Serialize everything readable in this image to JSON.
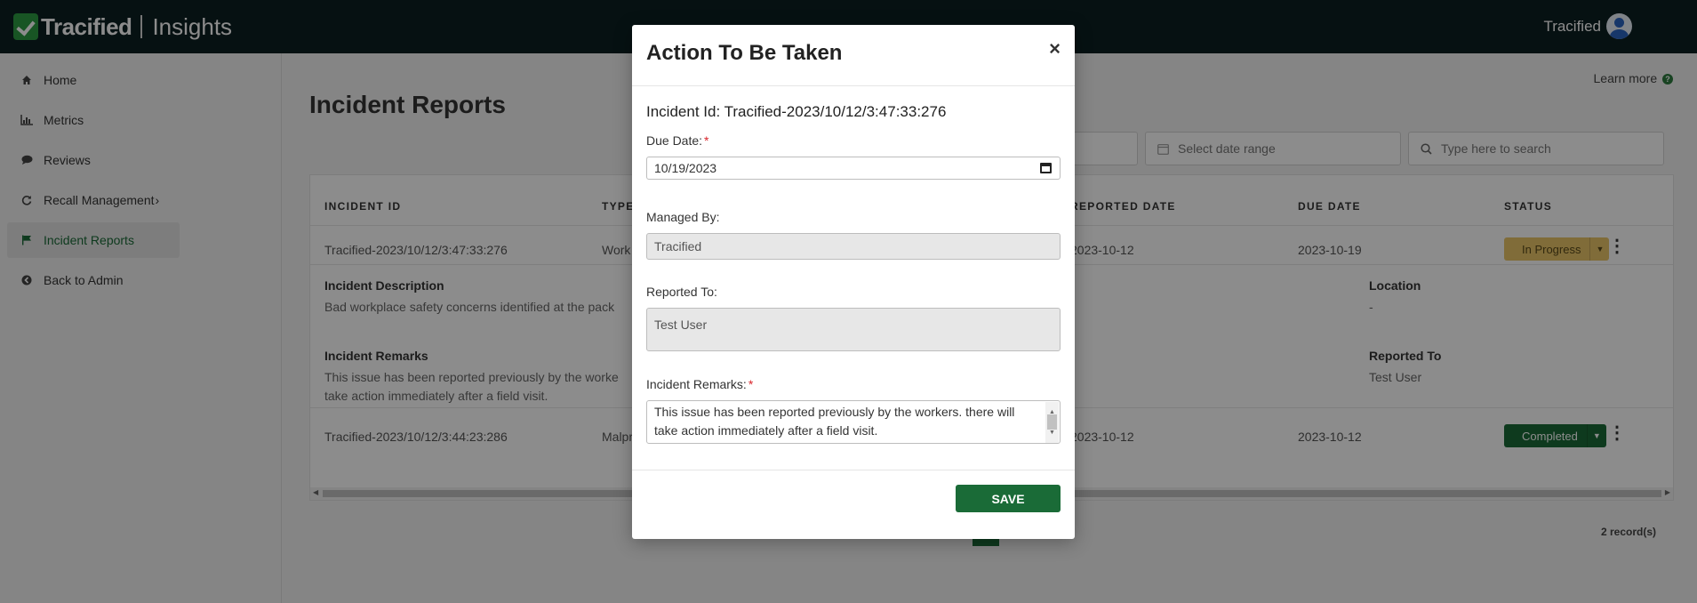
{
  "app": {
    "brand": "Tracified",
    "product": "Insights",
    "user_name": "Tracified"
  },
  "sidebar": {
    "items": [
      {
        "label": "Home",
        "icon": "home-icon"
      },
      {
        "label": "Metrics",
        "icon": "bar-chart-icon"
      },
      {
        "label": "Reviews",
        "icon": "comment-icon"
      },
      {
        "label": "Recall Management",
        "icon": "refresh-icon"
      },
      {
        "label": "Incident Reports",
        "icon": "flag-icon"
      },
      {
        "label": "Back to Admin",
        "icon": "arrow-left-circle-icon"
      }
    ]
  },
  "main": {
    "learn_more": "Learn more",
    "title": "Incident Reports",
    "filters": {
      "date_placeholder": "Select date range",
      "search_placeholder": "Type here to search"
    },
    "columns": [
      "INCIDENT ID",
      "TYPE",
      "REPORTED DATE",
      "DUE DATE",
      "STATUS"
    ],
    "rows": [
      {
        "incident_id": "Tracified-2023/10/12/3:47:33:276",
        "type": "Work",
        "reported_date": "2023-10-12",
        "due_date": "2023-10-19",
        "status": "In Progress",
        "details": {
          "description_label": "Incident Description",
          "description": "Bad workplace safety concerns identified at the pack",
          "location_label": "Location",
          "location": "-",
          "remarks_label": "Incident Remarks",
          "remarks_line1": "This issue has been reported previously by the worke",
          "remarks_line2": "take action immediately after a field visit.",
          "reported_to_label": "Reported To",
          "reported_to": "Test User"
        }
      },
      {
        "incident_id": "Tracified-2023/10/12/3:44:23:286",
        "type": "Malpr",
        "reported_date": "2023-10-12",
        "due_date": "2023-10-12",
        "status": "Completed"
      }
    ],
    "records": "2 record(s)"
  },
  "modal": {
    "title": "Action To Be Taken",
    "close": "×",
    "incident_id_text": "Incident Id: Tracified-2023/10/12/3:47:33:276",
    "due_date_label": "Due Date:",
    "due_date_value": "10/19/2023",
    "managed_by_label": "Managed By:",
    "managed_by_value": "Tracified",
    "reported_to_label": "Reported To:",
    "reported_to_value": "Test User",
    "remarks_label": "Incident Remarks:",
    "remarks_value": "This issue has been reported previously by the workers. there will take action immediately after a field visit.",
    "required_mark": "*",
    "save_label": "SAVE"
  },
  "colors": {
    "topbar": "#0c1f21",
    "accent_green": "#1a6b37",
    "in_progress": "#e9c569",
    "required": "#d9262c"
  }
}
